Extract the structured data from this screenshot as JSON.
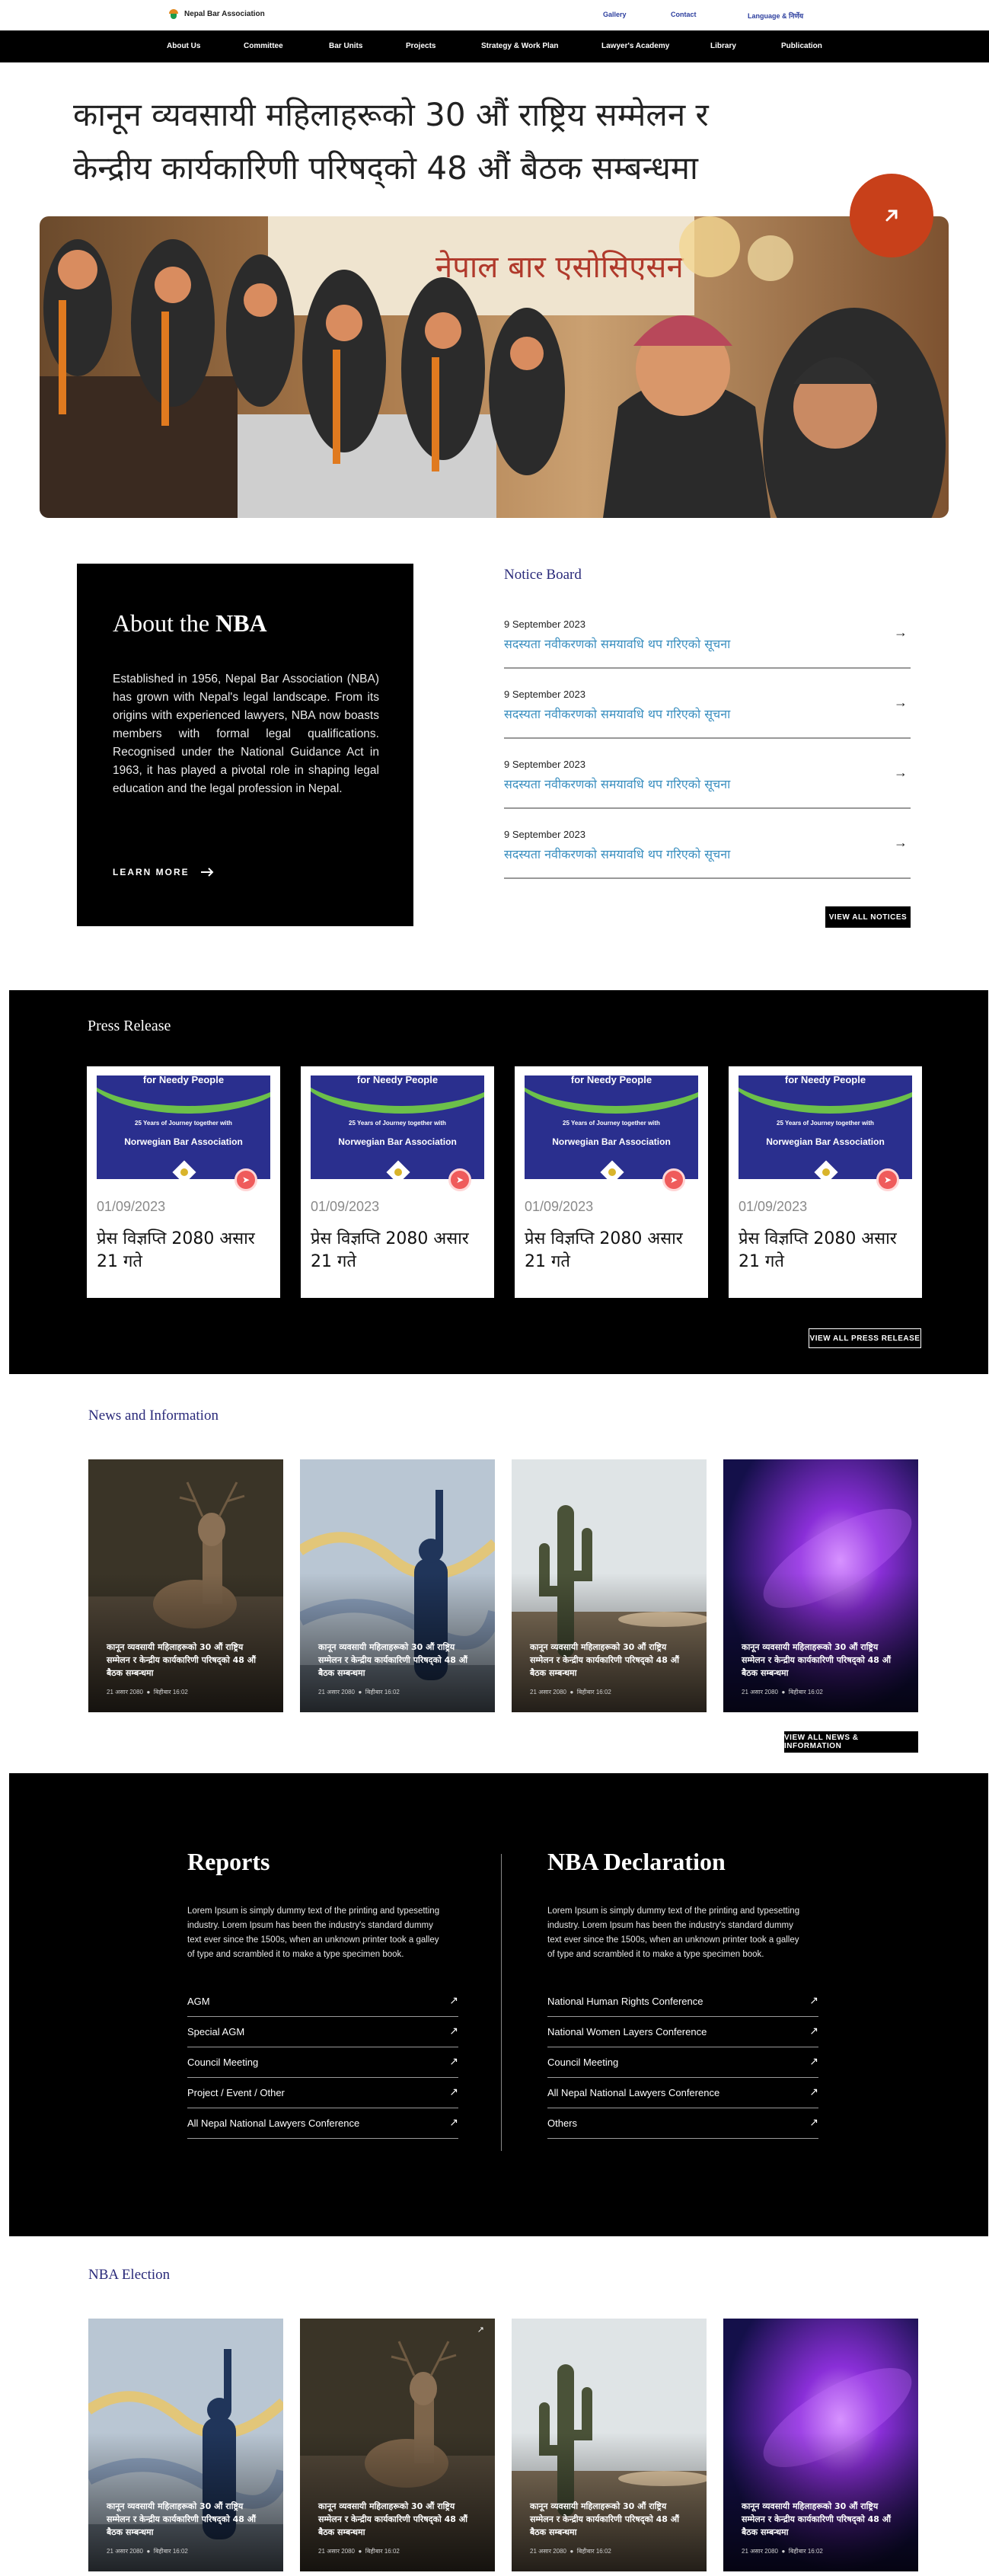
{
  "header": {
    "logo_text": "Nepal Bar Association",
    "links": [
      "Gallery",
      "Contact",
      "Language & निर्णेय"
    ]
  },
  "nav": [
    "About Us",
    "Committee",
    "Bar Units",
    "Projects",
    "Strategy & Work Plan",
    "Lawyer's Academy",
    "Library",
    "Publication"
  ],
  "hero": {
    "title_line1": "कानून व्यवसायी महिलाहरूको 30 औं राष्ट्रिय सम्मेलन र",
    "title_line2": "केन्द्रीय कार्यकारिणी परिषद्को 48 औं बैठक सम्बन्धमा",
    "banner_text": "नेपाल बार एसोसिएसन"
  },
  "about": {
    "title_prefix": "About the",
    "title_bold": "NBA",
    "text": "Established in 1956, Nepal Bar Association (NBA) has grown with Nepal's legal landscape. From its origins with experienced lawyers, NBA now boasts members with formal legal qualifications. Recognised under the National Guidance Act in 1963, it has played a pivotal role in shaping legal education and the legal profession in Nepal.",
    "link": "LEARN MORE"
  },
  "notice_board": {
    "title": "Notice Board",
    "items": [
      {
        "date": "9 September 2023",
        "text": "सदस्यता नवीकरणको समयावधि थप गरिएको सूचना"
      },
      {
        "date": "9 September 2023",
        "text": "सदस्यता नवीकरणको समयावधि थप गरिएको सूचना"
      },
      {
        "date": "9 September 2023",
        "text": "सदस्यता नवीकरणको समयावधि थप गरिएको सूचना"
      },
      {
        "date": "9 September 2023",
        "text": "सदस्यता नवीकरणको समयावधि थप गरिएको सूचना"
      }
    ],
    "button": "VIEW ALL NOTICES"
  },
  "press": {
    "title": "Press Release",
    "banner_top": "for Needy People",
    "banner_sub": "25 Years of Journey together with",
    "banner_org": "Norwegian Bar Association",
    "cards": [
      {
        "date": "01/09/2023",
        "title": "प्रेस विज्ञप्ति 2080 असार 21 गते"
      },
      {
        "date": "01/09/2023",
        "title": "प्रेस विज्ञप्ति 2080 असार 21 गते"
      },
      {
        "date": "01/09/2023",
        "title": "प्रेस विज्ञप्ति 2080 असार 21 गते"
      },
      {
        "date": "01/09/2023",
        "title": "प्रेस विज्ञप्ति 2080 असार 21 गते"
      }
    ],
    "button": "VIEW ALL PRESS RELEASE"
  },
  "news": {
    "title": "News and Information",
    "cards": [
      {
        "caption": "कानून व्यवसायी महिलाहरूको 30 औं राष्ट्रिय सम्मेलन र केन्द्रीय कार्यकारिणी परिषद्को 48 औं बैठक सम्बन्धमा",
        "date": "21 असार 2080",
        "time": "बिहीबार 16:02"
      },
      {
        "caption": "कानून व्यवसायी महिलाहरूको 30 औं राष्ट्रिय सम्मेलन र केन्द्रीय कार्यकारिणी परिषद्को 48 औं बैठक सम्बन्धमा",
        "date": "21 असार 2080",
        "time": "बिहीबार 16:02"
      },
      {
        "caption": "कानून व्यवसायी महिलाहरूको 30 औं राष्ट्रिय सम्मेलन र केन्द्रीय कार्यकारिणी परिषद्को 48 औं बैठक सम्बन्धमा",
        "date": "21 असार 2080",
        "time": "बिहीबार 16:02"
      },
      {
        "caption": "कानून व्यवसायी महिलाहरूको 30 औं राष्ट्रिय सम्मेलन र केन्द्रीय कार्यकारिणी परिषद्को 48 औं बैठक सम्बन्धमा",
        "date": "21 असार 2080",
        "time": "बिहीबार 16:02"
      }
    ],
    "button": "VIEW ALL NEWS & INFORMATION"
  },
  "reports": {
    "title": "Reports",
    "text": "Lorem Ipsum is simply dummy text of the printing and typesetting industry. Lorem Ipsum has been the industry's standard dummy text ever since the 1500s, when an unknown printer took a galley of type and scrambled it to make a type specimen book.",
    "items": [
      "AGM",
      "Special AGM",
      "Council Meeting",
      "Project / Event / Other",
      "All Nepal National Lawyers Conference"
    ]
  },
  "declaration": {
    "title": "NBA Declaration",
    "text": "Lorem Ipsum is simply dummy text of the printing and typesetting industry. Lorem Ipsum has been the industry's standard dummy text ever since the 1500s, when an unknown printer took a galley of type and scrambled it to make a type specimen book.",
    "items": [
      "National Human Rights Conference",
      "National Women Layers Conference",
      "Council Meeting",
      "All Nepal National Lawyers Conference",
      "Others"
    ]
  },
  "election": {
    "title": "NBA Election",
    "cards": [
      {
        "caption": "कानून व्यवसायी महिलाहरूको 30 औं राष्ट्रिय सम्मेलन र केन्द्रीय कार्यकारिणी परिषद्को 48 औं बैठक सम्बन्धमा",
        "date": "21 असार 2080",
        "time": "बिहीबार 16:02"
      },
      {
        "caption": "कानून व्यवसायी महिलाहरूको 30 औं राष्ट्रिय सम्मेलन र केन्द्रीय कार्यकारिणी परिषद्को 48 औं बैठक सम्बन्धमा",
        "date": "21 असार 2080",
        "time": "बिहीबार 16:02"
      },
      {
        "caption": "कानून व्यवसायी महिलाहरूको 30 औं राष्ट्रिय सम्मेलन र केन्द्रीय कार्यकारिणी परिषद्को 48 औं बैठक सम्बन्धमा",
        "date": "21 असार 2080",
        "time": "बिहीबार 16:02"
      },
      {
        "caption": "कानून व्यवसायी महिलाहरूको 30 औं राष्ट्रिय सम्मेलन र केन्द्रीय कार्यकारिणी परिषद्को 48 औं बैठक सम्बन्धमा",
        "date": "21 असार 2080",
        "time": "बिहीबार 16:02"
      }
    ]
  },
  "colors": {
    "accent_orange": "#c8401a",
    "notice_link": "#3a8fc0",
    "heading_navy": "#2a2a7a",
    "press_badge": "#ef5b5b"
  },
  "icons": [
    "arrow-right-icon",
    "arrow-up-right-icon",
    "send-icon"
  ]
}
